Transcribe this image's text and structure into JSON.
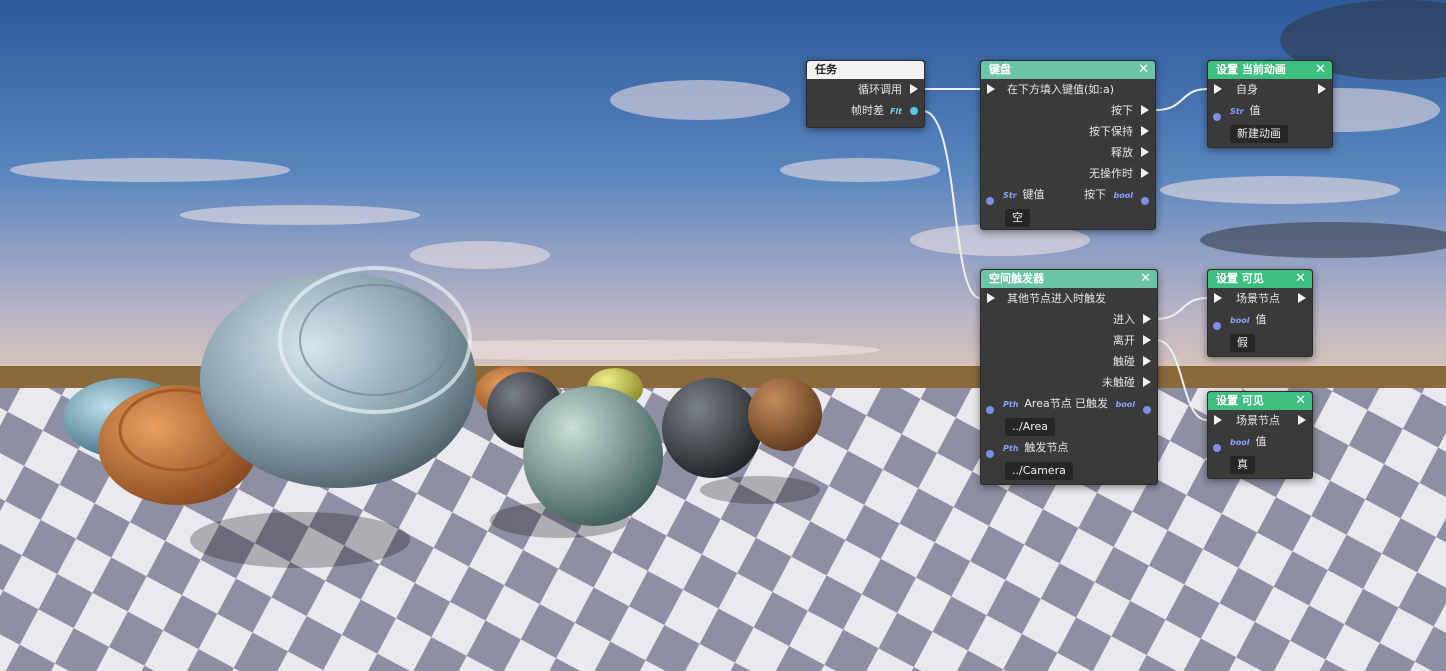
{
  "nodes": {
    "task": {
      "title": "任务",
      "loop_label": "循环调用",
      "delta_label": "帧时差",
      "delta_type": "Flt"
    },
    "keyboard": {
      "title": "键盘",
      "close": "✕",
      "instruction": "在下方填入键值(如:a)",
      "outputs": [
        "按下",
        "按下保持",
        "释放",
        "无操作时"
      ],
      "key_type": "Str",
      "key_label": "键值",
      "pressed_label": "按下",
      "pressed_type": "bool",
      "key_value": "空"
    },
    "trigger": {
      "title": "空间触发器",
      "close": "✕",
      "instruction": "其他节点进入时触发",
      "outputs": [
        "进入",
        "离开",
        "触碰",
        "未触碰"
      ],
      "area_type": "Pth",
      "area_label": "Area节点",
      "triggered_label": "已触发",
      "triggered_type": "bool",
      "area_value": "../Area",
      "trigger_type": "Pth",
      "trigger_label": "触发节点",
      "trigger_value": "../Camera"
    },
    "set_anim": {
      "title": "设置 当前动画",
      "close": "✕",
      "self_label": "自身",
      "value_type": "Str",
      "value_label": "值",
      "value": "新建动画"
    },
    "set_visible_1": {
      "title": "设置 可见",
      "close": "✕",
      "scene_label": "场景节点",
      "value_type": "bool",
      "value_label": "值",
      "value": "假"
    },
    "set_visible_2": {
      "title": "设置 可见",
      "close": "✕",
      "scene_label": "场景节点",
      "value_type": "bool",
      "value_label": "值",
      "value": "真"
    }
  },
  "colors": {
    "node_body": "#3a3a3a",
    "header_teal": "#6cc4a8",
    "header_green": "#3fbf7f",
    "header_task": "#f2f2f2",
    "bool_port": "#7f8ee6",
    "float_port": "#5ac6e6"
  }
}
